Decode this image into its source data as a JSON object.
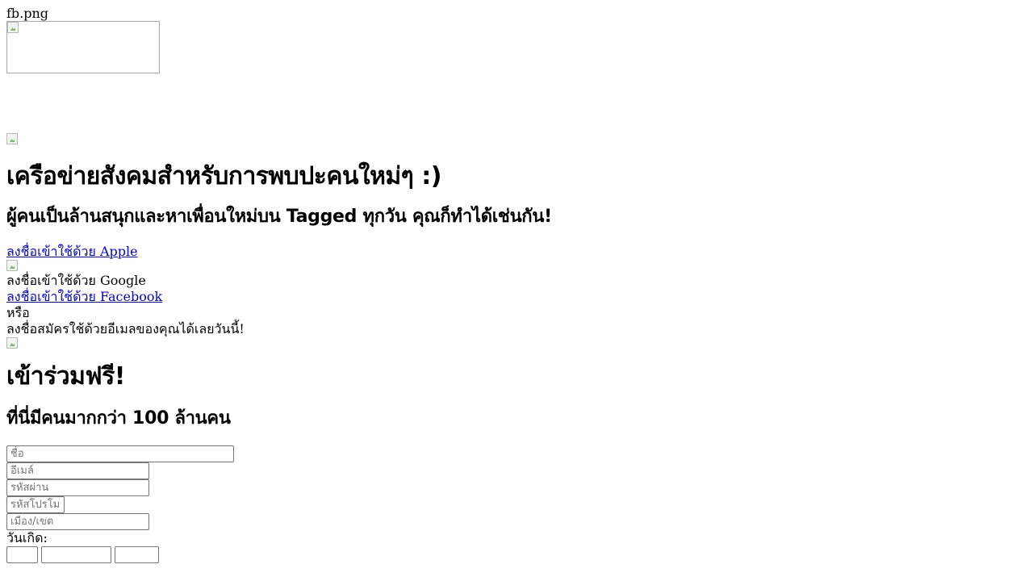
{
  "header": {
    "logo_alt": "fb.png"
  },
  "hero": {
    "title": "เครือข่ายสังคมสำหรับการพบปะคนใหม่ๆ :)",
    "subtitle": "ผู้คนเป็นล้านสนุกและหาเพื่อนใหม่บน Tagged ทุกวัน คุณก็ทำได้เช่นกัน!"
  },
  "social_login": {
    "apple": "ลงชื่อเข้าใช้ด้วย Apple",
    "google": "ลงชื่อเข้าใช้ด้วย Google",
    "facebook": "ลงชื่อเข้าใช้ด้วย Facebook",
    "or": "หรือ",
    "email_prompt": "ลงชื่อสมัครใช้ด้วยอีเมลของคุณได้เลยวันนี้!"
  },
  "signup": {
    "title": "เข้าร่วมฟรี!",
    "subtitle": "ที่นี่มีคนมากกว่า 100 ล้านคน",
    "name_placeholder": "ชื่อ",
    "email_placeholder": "อีเมล์",
    "password_placeholder": "รหัสผ่าน",
    "promo_placeholder": "รหัสโปรโมชั่น",
    "city_placeholder": "เมือง/เขต",
    "birthday_label": "วันเกิด:"
  }
}
